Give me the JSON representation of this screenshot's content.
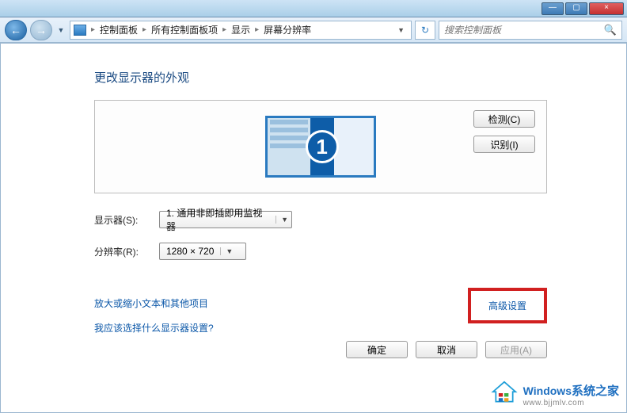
{
  "window": {
    "min": "—",
    "max": "▢",
    "close": "×"
  },
  "nav": {
    "back": "←",
    "forward": "→",
    "dropdown": "▼",
    "refresh": "↻"
  },
  "breadcrumb": {
    "items": [
      "控制面板",
      "所有控制面板项",
      "显示",
      "屏幕分辨率"
    ],
    "sep": "▸"
  },
  "search": {
    "placeholder": "搜索控制面板",
    "icon": "🔍"
  },
  "page": {
    "title": "更改显示器的外观",
    "monitor_number": "1",
    "detect": "检测(C)",
    "identify": "识别(I)"
  },
  "form": {
    "monitor_label": "显示器(S):",
    "monitor_value": "1. 通用非即插即用监视器",
    "resolution_label": "分辨率(R):",
    "resolution_value": "1280 × 720"
  },
  "links": {
    "advanced": "高级设置",
    "textsize": "放大或缩小文本和其他项目",
    "which": "我应该选择什么显示器设置?"
  },
  "footer": {
    "ok": "确定",
    "cancel": "取消",
    "apply": "应用(A)"
  },
  "watermark": {
    "brand": "Windows",
    "brand_cn": "系统之家",
    "url": "www.bjjmlv.com"
  }
}
